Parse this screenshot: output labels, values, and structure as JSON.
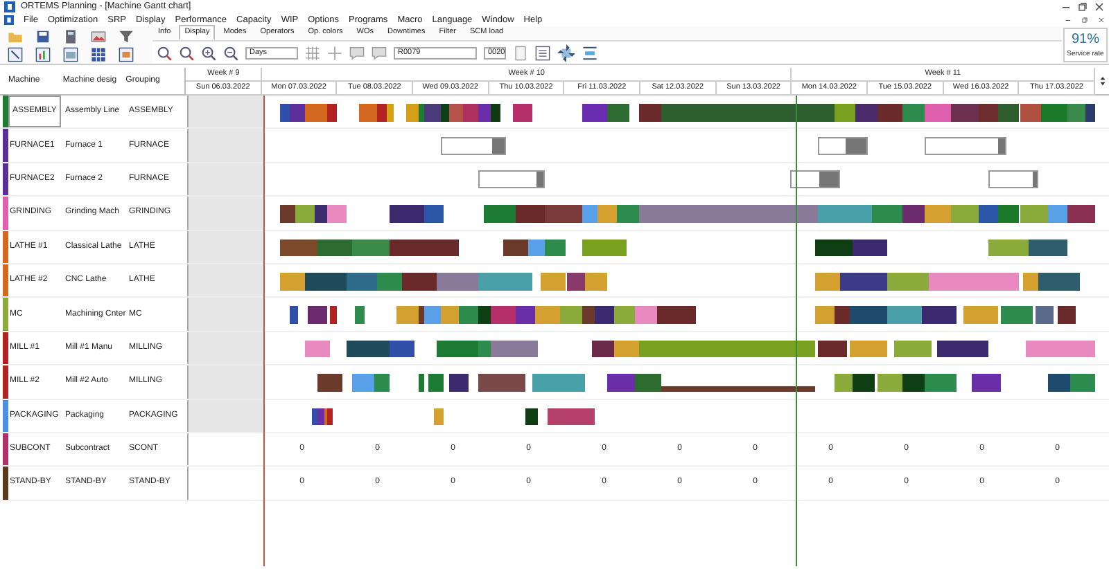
{
  "window": {
    "title": "ORTEMS  Planning - [Machine Gantt chart]"
  },
  "menu": [
    "File",
    "Optimization",
    "SRP",
    "Display",
    "Performance",
    "Capacity",
    "WIP",
    "Options",
    "Programs",
    "Macro",
    "Language",
    "Window",
    "Help"
  ],
  "ribbon": {
    "tabs": [
      {
        "label": "Info",
        "selected": false
      },
      {
        "label": "Display",
        "selected": true
      },
      {
        "label": "Modes",
        "selected": false
      },
      {
        "label": "Operators",
        "selected": false
      },
      {
        "label": "Op. colors",
        "selected": false
      },
      {
        "label": "WOs",
        "selected": false
      },
      {
        "label": "Downtimes",
        "selected": false
      },
      {
        "label": "Filter",
        "selected": false
      },
      {
        "label": "SCM load",
        "selected": false
      }
    ],
    "scale_select": {
      "value": "Days"
    },
    "resource_field": {
      "value": "R0079"
    },
    "number_field": {
      "value": "0020"
    }
  },
  "service_rate": {
    "value": "91%",
    "label": "Service rate"
  },
  "columns": [
    "Machine",
    "Machine desig",
    "Grouping"
  ],
  "weeks": [
    {
      "label": "Week # 9",
      "days": [
        {
          "label": "Sun 06.03.2022",
          "shaded": true
        }
      ]
    },
    {
      "label": "Week # 10",
      "days": [
        {
          "label": "Mon 07.03.2022",
          "shaded": false
        },
        {
          "label": "Tue 08.03.2022",
          "shaded": false
        },
        {
          "label": "Wed 09.03.2022",
          "shaded": false
        },
        {
          "label": "Thu 10.03.2022",
          "shaded": false
        },
        {
          "label": "Fri 11.03.2022",
          "shaded": false
        },
        {
          "label": "Sat 12.03.2022",
          "shaded": false
        },
        {
          "label": "Sun 13.03.2022",
          "shaded": false
        }
      ]
    },
    {
      "label": "Week # 11",
      "days": [
        {
          "label": "Mon 14.03.2022",
          "shaded": false
        },
        {
          "label": "Tue 15.03.2022",
          "shaded": false
        },
        {
          "label": "Wed 16.03.2022",
          "shaded": false
        },
        {
          "label": "Thu 17.03.2022",
          "shaded": false
        }
      ]
    }
  ],
  "rows": [
    {
      "machine": "ASSEMBLY",
      "designation": "Assembly Line",
      "grouping": "ASSEMBLY",
      "color": "#1e7b34",
      "selected": true,
      "kind": "bars"
    },
    {
      "machine": "FURNACE1",
      "designation": "Furnace 1",
      "grouping": "FURNACE",
      "color": "#5a2f9a",
      "selected": false,
      "kind": "batches"
    },
    {
      "machine": "FURNACE2",
      "designation": "Furnace 2",
      "grouping": "FURNACE",
      "color": "#5a2f9a",
      "selected": false,
      "kind": "batches"
    },
    {
      "machine": "GRINDING",
      "designation": "Grinding Mach",
      "grouping": "GRINDING",
      "color": "#e060b0",
      "selected": false,
      "kind": "bars"
    },
    {
      "machine": "LATHE #1",
      "designation": "Classical Lathe",
      "grouping": "LATHE",
      "color": "#d2691e",
      "selected": false,
      "kind": "bars"
    },
    {
      "machine": "LATHE #2",
      "designation": "CNC Lathe",
      "grouping": "LATHE",
      "color": "#d2691e",
      "selected": false,
      "kind": "bars"
    },
    {
      "machine": "MC",
      "designation": "Machining Cnter",
      "grouping": "MC",
      "color": "#8aab3c",
      "selected": false,
      "kind": "bars"
    },
    {
      "machine": "MILL #1",
      "designation": "Mill #1 Manu",
      "grouping": "MILLING",
      "color": "#b22222",
      "selected": false,
      "kind": "bars"
    },
    {
      "machine": "MILL #2",
      "designation": "Mill #2 Auto",
      "grouping": "MILLING",
      "color": "#b22222",
      "selected": false,
      "kind": "bars"
    },
    {
      "machine": "PACKAGING",
      "designation": "Packaging",
      "grouping": "PACKAGING",
      "color": "#4a90e2",
      "selected": false,
      "kind": "bars"
    },
    {
      "machine": "SUBCONT",
      "designation": "Subcontract",
      "grouping": "SCONT",
      "color": "#b0306a",
      "selected": false,
      "kind": "counts",
      "cells": [
        "0",
        "0",
        "0",
        "0",
        "0",
        "0",
        "0",
        "0",
        "0",
        "0",
        "0"
      ]
    },
    {
      "machine": "STAND-BY",
      "designation": "STAND-BY",
      "grouping": "STAND-BY",
      "color": "#5a3a1e",
      "selected": false,
      "kind": "counts",
      "cells": [
        "0",
        "0",
        "0",
        "0",
        "0",
        "0",
        "0",
        "0",
        "0",
        "0",
        "0"
      ]
    }
  ]
}
